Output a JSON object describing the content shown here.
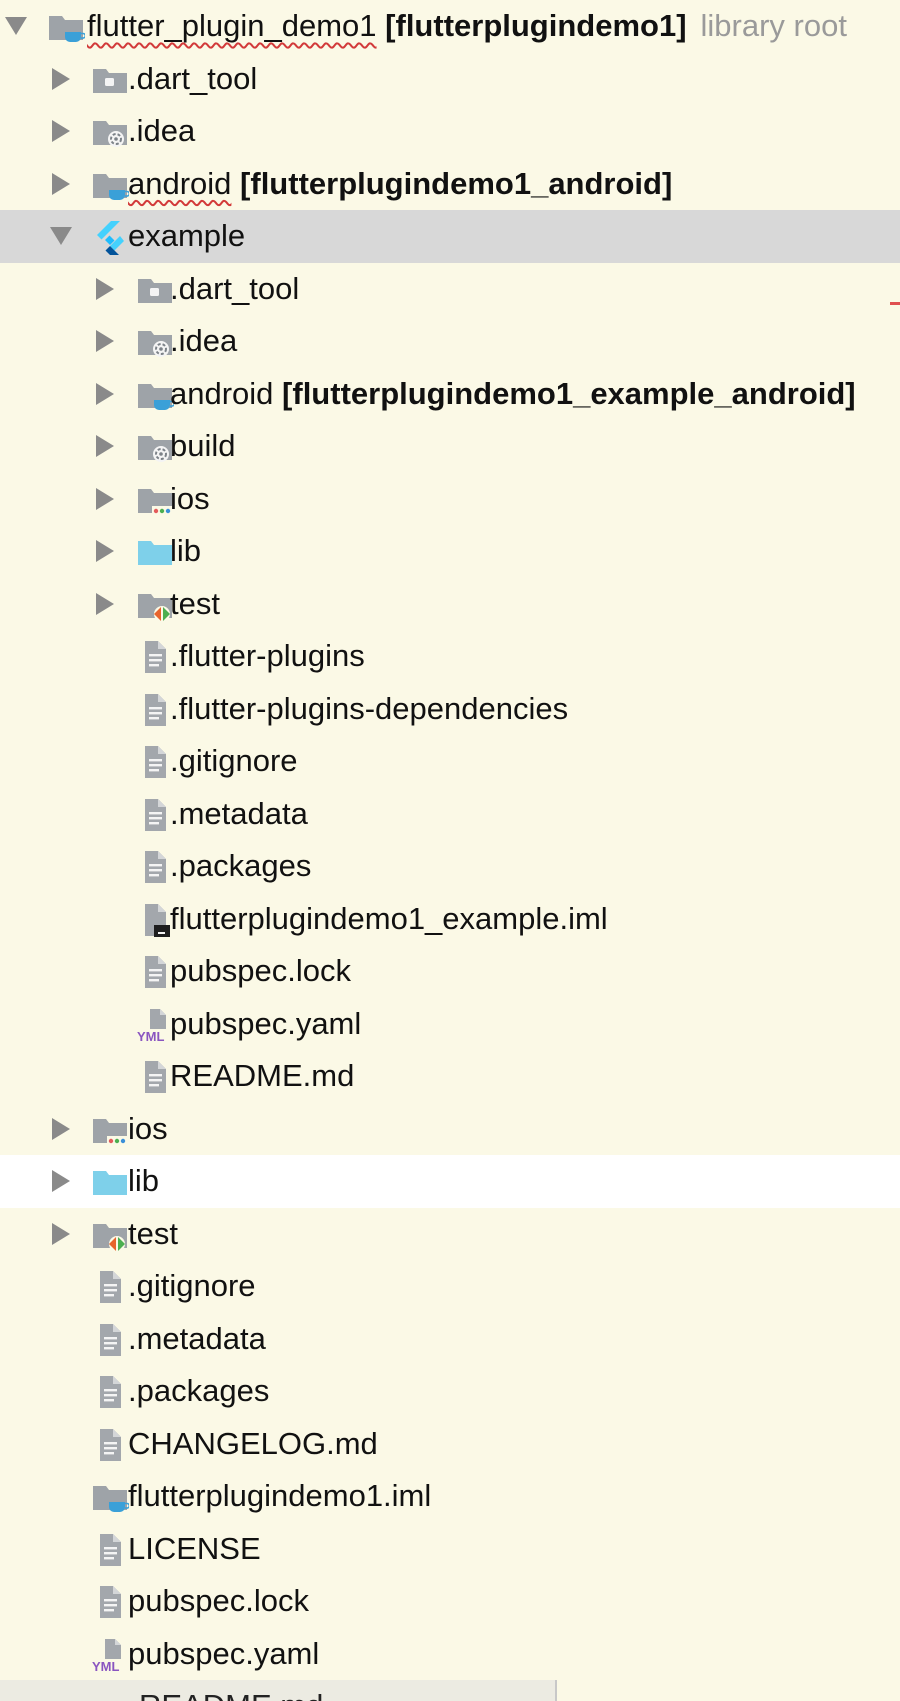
{
  "tree": {
    "rows": [
      {
        "depth": 0,
        "arrow": "down",
        "icon": "module-folder-icon",
        "text": "flutter_plugin_demo1",
        "squiggle": true,
        "bold": "[flutterplugindemo1]",
        "muted": "library root"
      },
      {
        "depth": 1,
        "arrow": "right",
        "icon": "excluded-folder-icon",
        "text": ".dart_tool"
      },
      {
        "depth": 1,
        "arrow": "right",
        "icon": "config-folder-icon",
        "text": ".idea"
      },
      {
        "depth": 1,
        "arrow": "right",
        "icon": "module-folder-icon",
        "text": "android",
        "squiggle": true,
        "bold": "[flutterplugindemo1_android]"
      },
      {
        "depth": 1,
        "arrow": "down",
        "icon": "flutter-icon",
        "text": "example",
        "selected": true
      },
      {
        "depth": 2,
        "arrow": "right",
        "icon": "excluded-folder-icon",
        "text": ".dart_tool"
      },
      {
        "depth": 2,
        "arrow": "right",
        "icon": "config-folder-icon",
        "text": ".idea"
      },
      {
        "depth": 2,
        "arrow": "right",
        "icon": "module-folder-icon",
        "text": "android",
        "bold": "[flutterplugindemo1_example_android]"
      },
      {
        "depth": 2,
        "arrow": "right",
        "icon": "config-folder-icon",
        "text": "build"
      },
      {
        "depth": 2,
        "arrow": "right",
        "icon": "ios-folder-icon",
        "text": "ios"
      },
      {
        "depth": 2,
        "arrow": "right",
        "icon": "source-folder-icon",
        "text": "lib"
      },
      {
        "depth": 2,
        "arrow": "right",
        "icon": "test-folder-icon",
        "text": "test"
      },
      {
        "depth": 2,
        "arrow": "none",
        "icon": "text-file-icon",
        "text": ".flutter-plugins"
      },
      {
        "depth": 2,
        "arrow": "none",
        "icon": "text-file-icon",
        "text": ".flutter-plugins-dependencies"
      },
      {
        "depth": 2,
        "arrow": "none",
        "icon": "text-file-icon",
        "text": ".gitignore"
      },
      {
        "depth": 2,
        "arrow": "none",
        "icon": "text-file-icon",
        "text": ".metadata"
      },
      {
        "depth": 2,
        "arrow": "none",
        "icon": "text-file-icon",
        "text": ".packages"
      },
      {
        "depth": 2,
        "arrow": "none",
        "icon": "iml-file-icon",
        "text": "flutterplugindemo1_example.iml"
      },
      {
        "depth": 2,
        "arrow": "none",
        "icon": "text-file-icon",
        "text": "pubspec.lock"
      },
      {
        "depth": 2,
        "arrow": "none",
        "icon": "yaml-file-icon",
        "text": "pubspec.yaml"
      },
      {
        "depth": 2,
        "arrow": "none",
        "icon": "text-file-icon",
        "text": "README.md"
      },
      {
        "depth": 1,
        "arrow": "right",
        "icon": "ios-folder-icon",
        "text": "ios"
      },
      {
        "depth": 1,
        "arrow": "right",
        "icon": "source-folder-icon",
        "text": "lib",
        "hover": true
      },
      {
        "depth": 1,
        "arrow": "right",
        "icon": "test-folder-icon",
        "text": "test"
      },
      {
        "depth": 1,
        "arrow": "none",
        "icon": "text-file-icon",
        "text": ".gitignore"
      },
      {
        "depth": 1,
        "arrow": "none",
        "icon": "text-file-icon",
        "text": ".metadata"
      },
      {
        "depth": 1,
        "arrow": "none",
        "icon": "text-file-icon",
        "text": ".packages"
      },
      {
        "depth": 1,
        "arrow": "none",
        "icon": "text-file-icon",
        "text": "CHANGELOG.md"
      },
      {
        "depth": 1,
        "arrow": "none",
        "icon": "module-folder-icon",
        "text": "flutterplugindemo1.iml"
      },
      {
        "depth": 1,
        "arrow": "none",
        "icon": "text-file-icon",
        "text": "LICENSE"
      },
      {
        "depth": 1,
        "arrow": "none",
        "icon": "text-file-icon",
        "text": "pubspec.lock"
      },
      {
        "depth": 1,
        "arrow": "none",
        "icon": "yaml-file-icon",
        "text": "pubspec.yaml"
      }
    ],
    "partial_last_row": "README.md"
  }
}
